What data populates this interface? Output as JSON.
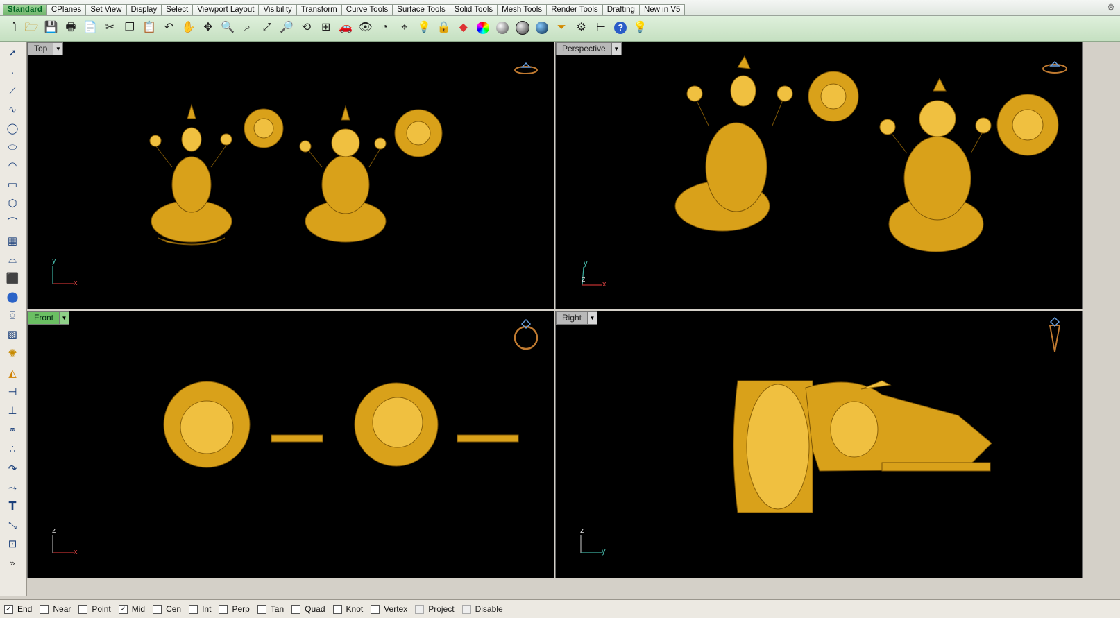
{
  "tabs": [
    {
      "label": "Standard",
      "active": true
    },
    {
      "label": "CPlanes"
    },
    {
      "label": "Set View"
    },
    {
      "label": "Display"
    },
    {
      "label": "Select"
    },
    {
      "label": "Viewport Layout"
    },
    {
      "label": "Visibility"
    },
    {
      "label": "Transform"
    },
    {
      "label": "Curve Tools"
    },
    {
      "label": "Surface Tools"
    },
    {
      "label": "Solid Tools"
    },
    {
      "label": "Mesh Tools"
    },
    {
      "label": "Render Tools"
    },
    {
      "label": "Drafting"
    },
    {
      "label": "New in V5"
    }
  ],
  "toolbar_icons": [
    "new-file-icon",
    "open-file-icon",
    "save-icon",
    "print-icon",
    "import-icon",
    "cut-icon",
    "copy-icon",
    "paste-icon",
    "undo-icon",
    "pan-icon",
    "rotate-view-icon",
    "zoom-window-icon",
    "zoom-dynamic-icon",
    "zoom-extents-icon",
    "zoom-selected-icon",
    "rotate-icon",
    "four-views-icon",
    "car-icon",
    "eye-icon",
    "cplane-icon",
    "snap-icon",
    "light-bulb-icon",
    "lock-icon",
    "layer-icon",
    "color-wheel-icon",
    "shaded-sphere-icon",
    "rendered-sphere-icon",
    "blue-sphere-icon",
    "filter-icon",
    "settings-icon",
    "dimension-icon",
    "help-icon",
    "bulb-settings-icon"
  ],
  "left_icons": [
    "select-arrow-icon",
    "point-icon",
    "polyline-icon",
    "curve-icon",
    "circle-icon",
    "ellipse-icon",
    "arc-icon",
    "rectangle-icon",
    "polygon-icon",
    "fillet-icon",
    "surface-icon",
    "loft-icon",
    "box-icon",
    "sphere-icon",
    "cylinder-icon",
    "surface-edit-icon",
    "transform-icon",
    "gumball-icon",
    "split-icon",
    "trim-icon",
    "boolean-icon",
    "explode-icon",
    "curve-edit-icon",
    "blend-icon",
    "text-icon",
    "scale-icon",
    "group-icon",
    "more-icon"
  ],
  "viewports": {
    "top": {
      "name": "Top",
      "active": false,
      "axes": {
        "v": "y",
        "h": "x"
      }
    },
    "perspective": {
      "name": "Perspective",
      "active": false,
      "axes": {
        "v": "y",
        "h": "x",
        "z": "z"
      }
    },
    "front": {
      "name": "Front",
      "active": true,
      "axes": {
        "v": "z",
        "h": "x"
      }
    },
    "right": {
      "name": "Right",
      "active": false,
      "axes": {
        "v": "z",
        "h": "y"
      }
    }
  },
  "osnap": [
    {
      "label": "End",
      "checked": true
    },
    {
      "label": "Near",
      "checked": false
    },
    {
      "label": "Point",
      "checked": false
    },
    {
      "label": "Mid",
      "checked": true
    },
    {
      "label": "Cen",
      "checked": false
    },
    {
      "label": "Int",
      "checked": false
    },
    {
      "label": "Perp",
      "checked": false
    },
    {
      "label": "Tan",
      "checked": false
    },
    {
      "label": "Quad",
      "checked": false
    },
    {
      "label": "Knot",
      "checked": false
    },
    {
      "label": "Vertex",
      "checked": false
    },
    {
      "label": "Project",
      "checked": false,
      "disabled": true
    },
    {
      "label": "Disable",
      "checked": false,
      "disabled": true
    }
  ],
  "colors": {
    "gold": "#d9a11a",
    "active_label": "#6bbf63",
    "viewport_bg": "#000000"
  }
}
